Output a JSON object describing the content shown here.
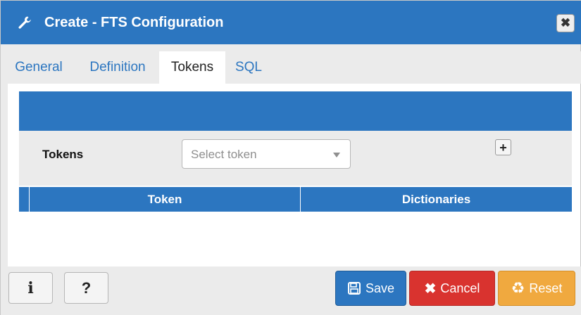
{
  "dialog": {
    "title": "Create - FTS Configuration",
    "title_icon": "wrench-icon",
    "close_icon": "close-icon"
  },
  "tabs": [
    {
      "label": "General",
      "active": false
    },
    {
      "label": "Definition",
      "active": false
    },
    {
      "label": "Tokens",
      "active": true
    },
    {
      "label": "SQL",
      "active": false
    }
  ],
  "tokens_panel": {
    "label": "Tokens",
    "select_placeholder": "Select token",
    "add_icon": "plus-icon"
  },
  "grid": {
    "columns": [
      "Token",
      "Dictionaries"
    ],
    "rows": []
  },
  "footer": {
    "info_icon": "info-icon",
    "help_icon": "help-icon",
    "save_label": "Save",
    "cancel_label": "Cancel",
    "reset_label": "Reset"
  },
  "colors": {
    "primary": "#2c76c0",
    "danger": "#d9332f",
    "warning": "#f0a93f"
  }
}
